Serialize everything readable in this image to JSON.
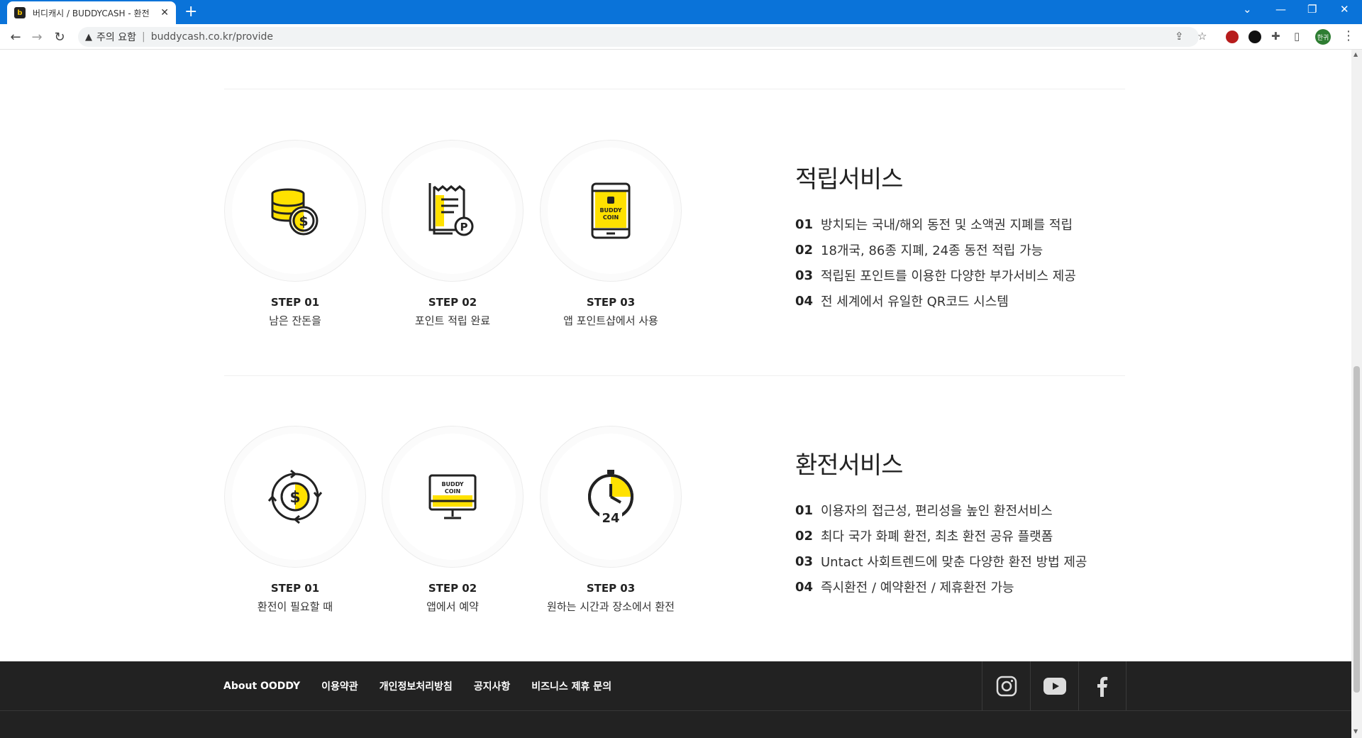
{
  "browser": {
    "tab_title": "버디캐시 / BUDDYCASH - 환전",
    "tab_close": "✕",
    "new_tab": "+",
    "security_label": "주의 요함",
    "url": "buddycash.co.kr/provide",
    "profile_label": "한귀",
    "favicon": "b"
  },
  "sections": [
    {
      "title": "적립서비스",
      "steps": [
        {
          "label": "STEP 01",
          "desc": "남은 잔돈을",
          "icon": "coins-icon"
        },
        {
          "label": "STEP 02",
          "desc": "포인트 적립 완료",
          "icon": "receipt-point-icon"
        },
        {
          "label": "STEP 03",
          "desc": "앱 포인트샵에서 사용",
          "icon": "phone-app-icon"
        }
      ],
      "items": [
        {
          "num": "01",
          "text": "방치되는 국내/해외 동전 및 소액권 지폐를 적립"
        },
        {
          "num": "02",
          "text": "18개국, 86종 지폐, 24종 동전 적립 가능"
        },
        {
          "num": "03",
          "text": "적립된 포인트를 이용한 다양한 부가서비스 제공"
        },
        {
          "num": "04",
          "text": "전 세계에서 유일한 QR코드 시스템"
        }
      ]
    },
    {
      "title": "환전서비스",
      "steps": [
        {
          "label": "STEP 01",
          "desc": "환전이 필요할 때",
          "icon": "exchange-cycle-icon"
        },
        {
          "label": "STEP 02",
          "desc": "앱에서 예약",
          "icon": "monitor-app-icon"
        },
        {
          "label": "STEP 03",
          "desc": "원하는 시간과 장소에서 환전",
          "icon": "clock-24-icon"
        }
      ],
      "items": [
        {
          "num": "01",
          "text": "이용자의 접근성, 편리성을 높인 환전서비스"
        },
        {
          "num": "02",
          "text": "최다 국가 화폐 환전, 최초 환전 공유 플랫폼"
        },
        {
          "num": "03",
          "text": "Untact 사회트렌드에 맞춘 다양한 환전 방법 제공"
        },
        {
          "num": "04",
          "text": "즉시환전 / 예약환전 / 제휴환전 가능"
        }
      ]
    }
  ],
  "icon_text": {
    "buddy": "BUDDY",
    "coin": "COIN",
    "dollar": "$",
    "point": "P",
    "hours": "24"
  },
  "footer": {
    "links": [
      "About OODDY",
      "이용약관",
      "개인정보처리방침",
      "공지사항",
      "비즈니스 제휴 문의"
    ],
    "social": [
      "instagram-icon",
      "youtube-icon",
      "facebook-icon"
    ]
  },
  "colors": {
    "accent": "#ffe100",
    "dark": "#222222",
    "chrome": "#0a73d9"
  }
}
